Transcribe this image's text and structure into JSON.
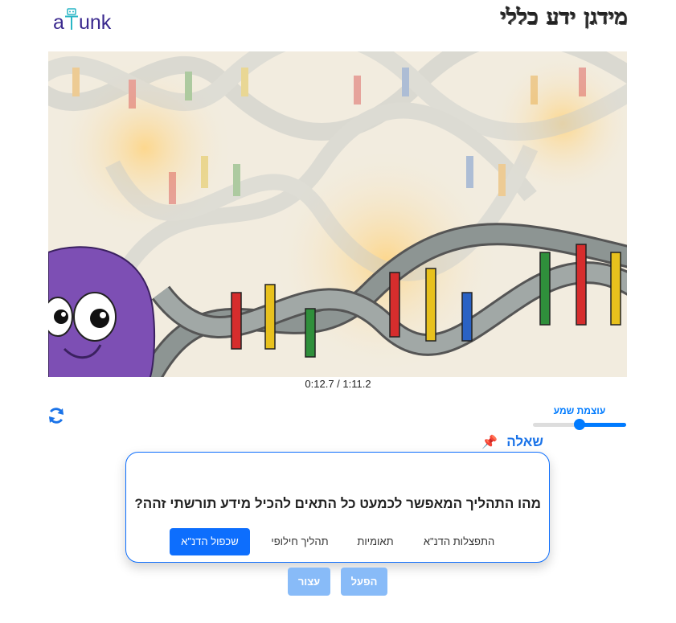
{
  "header": {
    "logo_text": "aitunk",
    "app_title": "מידגן ידע כללי"
  },
  "video": {
    "time_display": "0:12.7 / 1:11.2"
  },
  "controls": {
    "refresh_icon": "refresh-icon",
    "volume_label": "עוצמת שמע",
    "volume_level": 0.5
  },
  "question": {
    "label": "שאלה",
    "pin_icon": "pushpin-icon",
    "text": "מהו התהליך המאפשר לכמעט כל התאים להכיל מידע תורשתי זהה?",
    "answers": [
      {
        "label": "שכפול הדנ\"א",
        "selected": true
      },
      {
        "label": "תהליך חילופי",
        "selected": false
      },
      {
        "label": "תאומיות",
        "selected": false
      },
      {
        "label": "התפצלות הדנ\"א",
        "selected": false
      }
    ]
  },
  "buttons": {
    "play_label": "הפעל",
    "stop_label": "עצור"
  },
  "colors": {
    "accent": "#0d6efd",
    "disabled_button": "#88bbf8",
    "character": "#7d4fb4"
  }
}
